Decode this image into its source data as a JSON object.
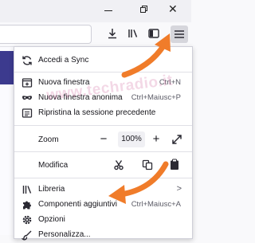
{
  "toolbar": {
    "icons": [
      "download-icon",
      "library-icon",
      "sidebar-icon",
      "hamburger-menu-icon"
    ]
  },
  "watermark": {
    "text": "www.techradio.it"
  },
  "menu": {
    "sync": {
      "label": "Accedi a Sync"
    },
    "new_window": {
      "label": "Nuova finestra",
      "shortcut": "Ctrl+N"
    },
    "private_window": {
      "label": "Nuova finestra anonima",
      "shortcut": "Ctrl+Maiusc+P"
    },
    "restore_session": {
      "label": "Ripristina la sessione precedente"
    },
    "zoom": {
      "label": "Zoom",
      "minus": "−",
      "value": "100%",
      "plus": "+"
    },
    "edit": {
      "label": "Modifica"
    },
    "library": {
      "label": "Libreria",
      "arrow": ">"
    },
    "addons": {
      "label": "Componenti aggiuntivi",
      "shortcut": "Ctrl+Maiusc+A"
    },
    "options": {
      "label": "Opzioni"
    },
    "customize": {
      "label": "Personalizza..."
    }
  },
  "colors": {
    "arrow": "#f07c2a",
    "toolbar_bg": "#f9f9fb",
    "menu_bg": "#ffffff"
  }
}
